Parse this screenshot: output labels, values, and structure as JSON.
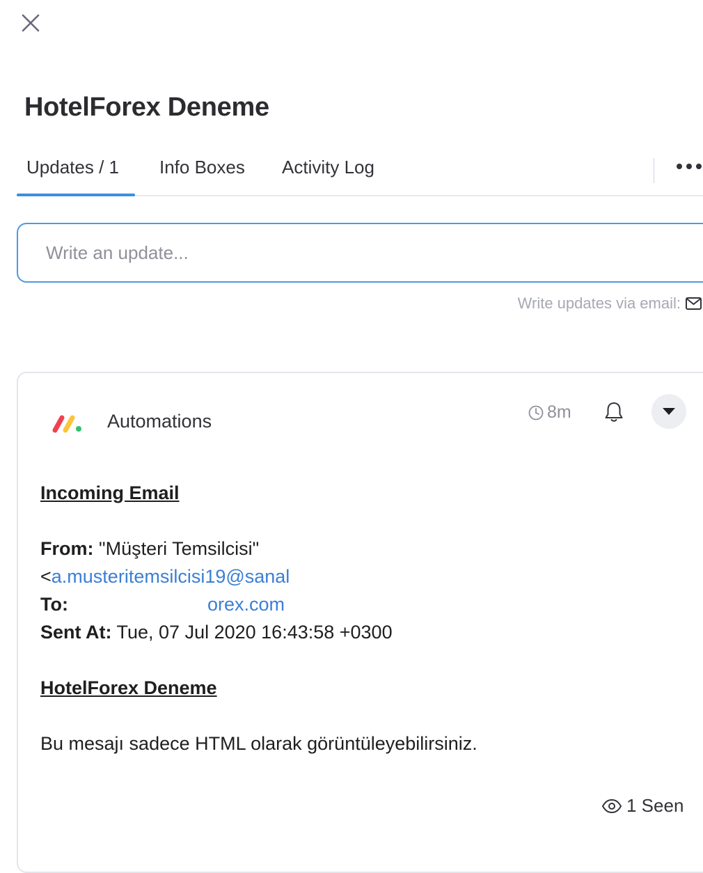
{
  "header": {
    "title": "HotelForex Deneme"
  },
  "tabs": [
    {
      "label": "Updates / 1",
      "active": true
    },
    {
      "label": "Info Boxes"
    },
    {
      "label": "Activity Log"
    }
  ],
  "composer": {
    "placeholder": "Write an update...",
    "email_hint": "Write updates via email:"
  },
  "update": {
    "author": "Automations",
    "time": "8m",
    "email": {
      "heading": "Incoming Email",
      "from_label": "From:",
      "from_name": "\"Müşteri Temsilcisi\"",
      "from_email_prefix": "<",
      "from_email": "a.musteritemsilcisi19@sanal",
      "to_label": "To:",
      "to_email_visible": "orex.com",
      "sent_label": "Sent At:",
      "sent_value": "Tue, 07 Jul 2020 16:43:58 +0300",
      "subject": "HotelForex Deneme",
      "message": "Bu mesajı sadece HTML olarak görüntüleyebilirsiniz."
    },
    "seen": "1 Seen"
  },
  "colors": {
    "accent": "#3b8fe0",
    "link": "#3b7fd6",
    "logo_red": "#f0424e",
    "logo_yellow": "#fbc43a",
    "logo_green": "#31c26a"
  },
  "icons": [
    "close-icon",
    "more-icon",
    "envelope-icon",
    "logo-icon",
    "clock-icon",
    "bell-icon",
    "caret-down-icon",
    "eye-icon"
  ]
}
